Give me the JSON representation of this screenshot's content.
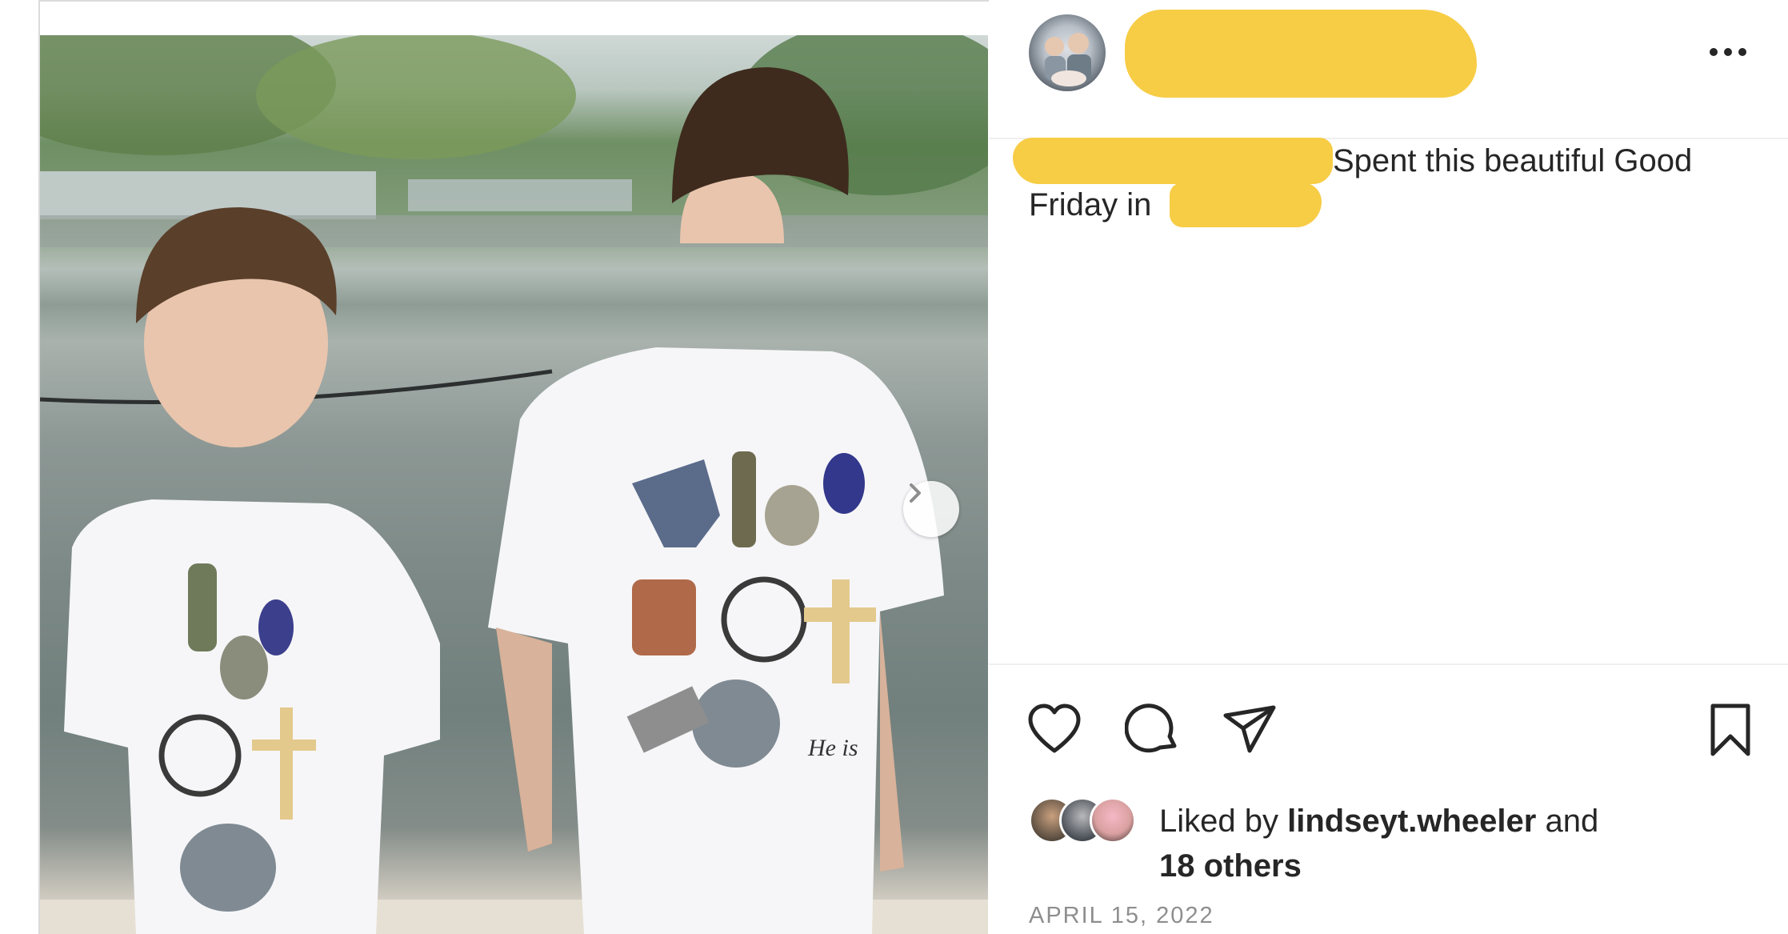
{
  "post": {
    "caption_line1": "Spent this beautiful Good",
    "caption_line2": "Friday in",
    "more_label": "More options",
    "next_label": "Next"
  },
  "likes": {
    "prefix": "Liked by ",
    "username": "lindseyt.wheeler",
    "conjunction": " and",
    "others": "18 others"
  },
  "date": "APRIL 15, 2022",
  "icons": {
    "like": "heart-icon",
    "comment": "comment-icon",
    "share": "paper-plane-icon",
    "save": "bookmark-icon",
    "more": "ellipsis-icon",
    "next": "chevron-right-icon"
  },
  "colors": {
    "redaction": "#f7cd46",
    "text": "#262626",
    "muted": "#8e8e8e"
  }
}
